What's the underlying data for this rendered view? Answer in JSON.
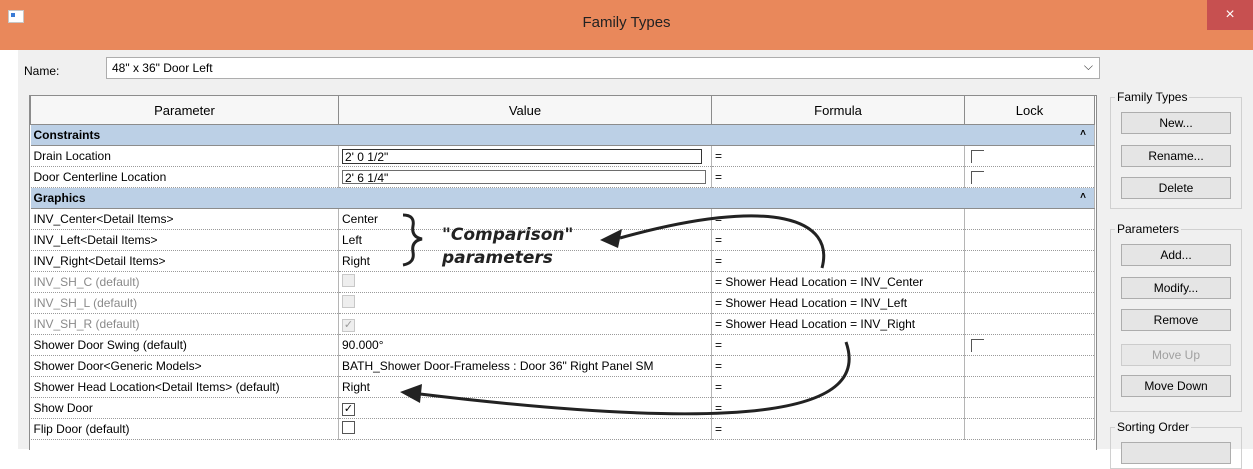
{
  "window": {
    "title": "Family Types",
    "close_glyph": "×"
  },
  "name_field": {
    "label": "Name:",
    "value": "48\" x 36\" Door Left"
  },
  "table": {
    "headers": {
      "parameter": "Parameter",
      "value": "Value",
      "formula": "Formula",
      "lock": "Lock"
    },
    "groups": {
      "constraints": "Constraints",
      "graphics": "Graphics"
    },
    "rows": [
      {
        "parameter": "Drain Location",
        "value": "2'  0 1/2\"",
        "formula": "=",
        "lock": "unchecked"
      },
      {
        "parameter": "Door Centerline Location",
        "value": "2'  6 1/4\"",
        "formula": "=",
        "lock": "unchecked"
      },
      {
        "parameter": "INV_Center<Detail Items>",
        "value": "Center",
        "formula": "="
      },
      {
        "parameter": "INV_Left<Detail Items>",
        "value": "Left",
        "formula": "="
      },
      {
        "parameter": "INV_Right<Detail Items>",
        "value": "Right",
        "formula": "="
      },
      {
        "parameter": "INV_SH_C (default)",
        "value": "",
        "formula": "= Shower Head Location = INV_Center"
      },
      {
        "parameter": "INV_SH_L (default)",
        "value": "",
        "formula": "= Shower Head Location = INV_Left"
      },
      {
        "parameter": "INV_SH_R (default)",
        "value": "✓",
        "formula": "= Shower Head Location = INV_Right"
      },
      {
        "parameter": "Shower Door Swing (default)",
        "value": "90.000°",
        "formula": "=",
        "lock": "unchecked"
      },
      {
        "parameter": "Shower Door<Generic Models>",
        "value": "BATH_Shower Door-Frameless : Door 36\" Right Panel SM",
        "formula": "="
      },
      {
        "parameter": "Shower Head Location<Detail Items> (default)",
        "value": "Right",
        "formula": "="
      },
      {
        "parameter": "Show Door",
        "value": "✓",
        "formula": "="
      },
      {
        "parameter": "Flip Door (default)",
        "value": "",
        "formula": "="
      }
    ]
  },
  "family_types_group": {
    "title": "Family Types",
    "new": "New...",
    "rename": "Rename...",
    "delete": "Delete"
  },
  "parameters_group": {
    "title": "Parameters",
    "add": "Add...",
    "modify": "Modify...",
    "remove": "Remove",
    "move_up": "Move Up",
    "move_down": "Move Down"
  },
  "sorting_group": {
    "title": "Sorting Order"
  },
  "annotation": {
    "line1": "\"Comparison\"",
    "line2": "parameters"
  }
}
